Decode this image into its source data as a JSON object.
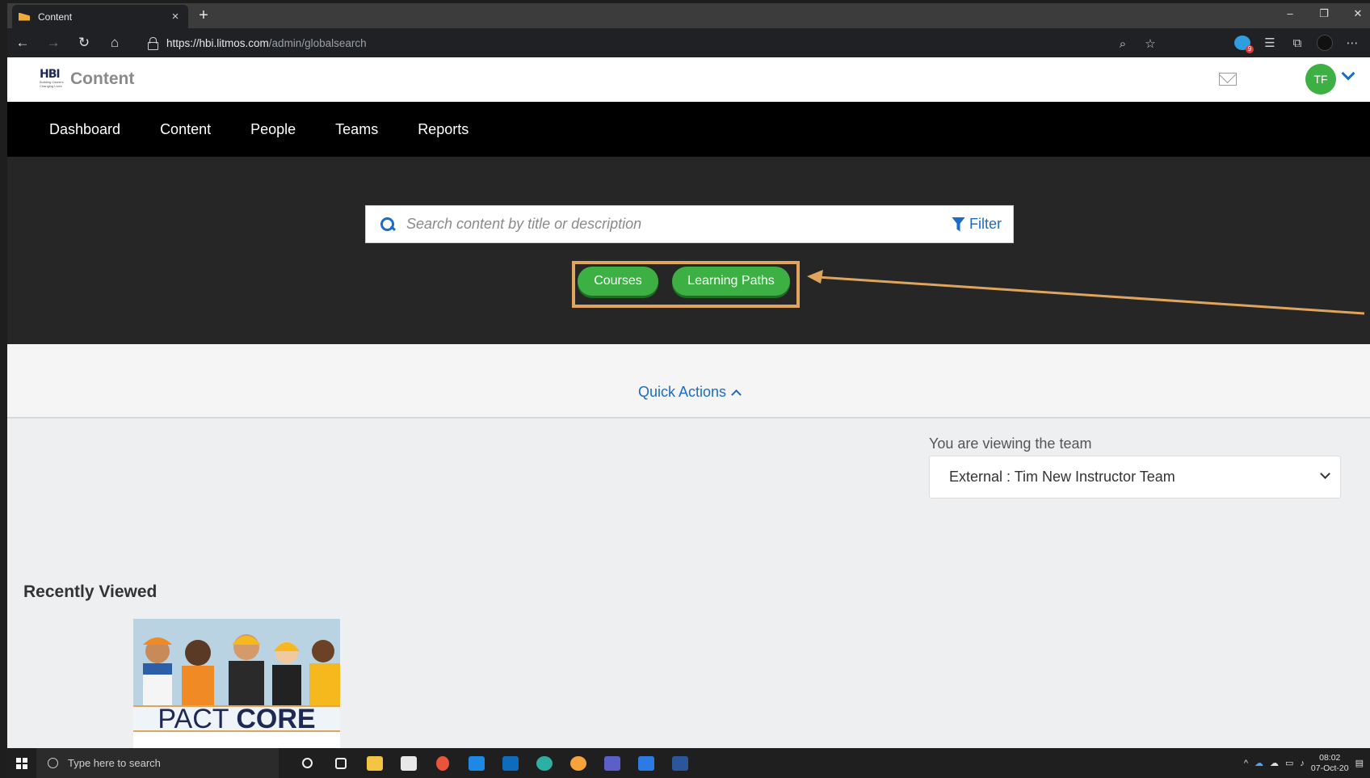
{
  "browser": {
    "tab_title": "Content",
    "tab_close": "×",
    "new_tab": "+",
    "url_host": "https://hbi.litmos.com",
    "url_path": "/admin/globalsearch",
    "window_controls": [
      "–",
      "❐",
      "✕"
    ]
  },
  "header": {
    "app_title": "Content",
    "logo_text": "HBI",
    "logo_tagline": "Building Careers Changing Lives",
    "avatar_initials": "TF"
  },
  "nav": {
    "items": [
      "Dashboard",
      "Content",
      "People",
      "Teams",
      "Reports"
    ]
  },
  "search": {
    "placeholder": "Search content by title or description",
    "value": "",
    "filter_label": "Filter"
  },
  "pills": {
    "courses": "Courses",
    "learning_paths": "Learning Paths"
  },
  "quick_actions": {
    "label": "Quick Actions"
  },
  "team": {
    "label": "You are viewing the team",
    "selected": "External : Tim New Instructor Team"
  },
  "recently_viewed": {
    "title": "Recently Viewed",
    "items": [
      {
        "caption_light": "PACT ",
        "caption_bold": "CORE"
      }
    ]
  },
  "taskbar": {
    "search_placeholder": "Type here to search",
    "time": "08:02",
    "date": "07-Oct-20"
  },
  "colors": {
    "accent_blue": "#1a6cc9",
    "pill_green": "#3cb043",
    "highlight_orange": "#dfa55c",
    "hero_bg": "#262626",
    "nav_bg": "#000000"
  }
}
